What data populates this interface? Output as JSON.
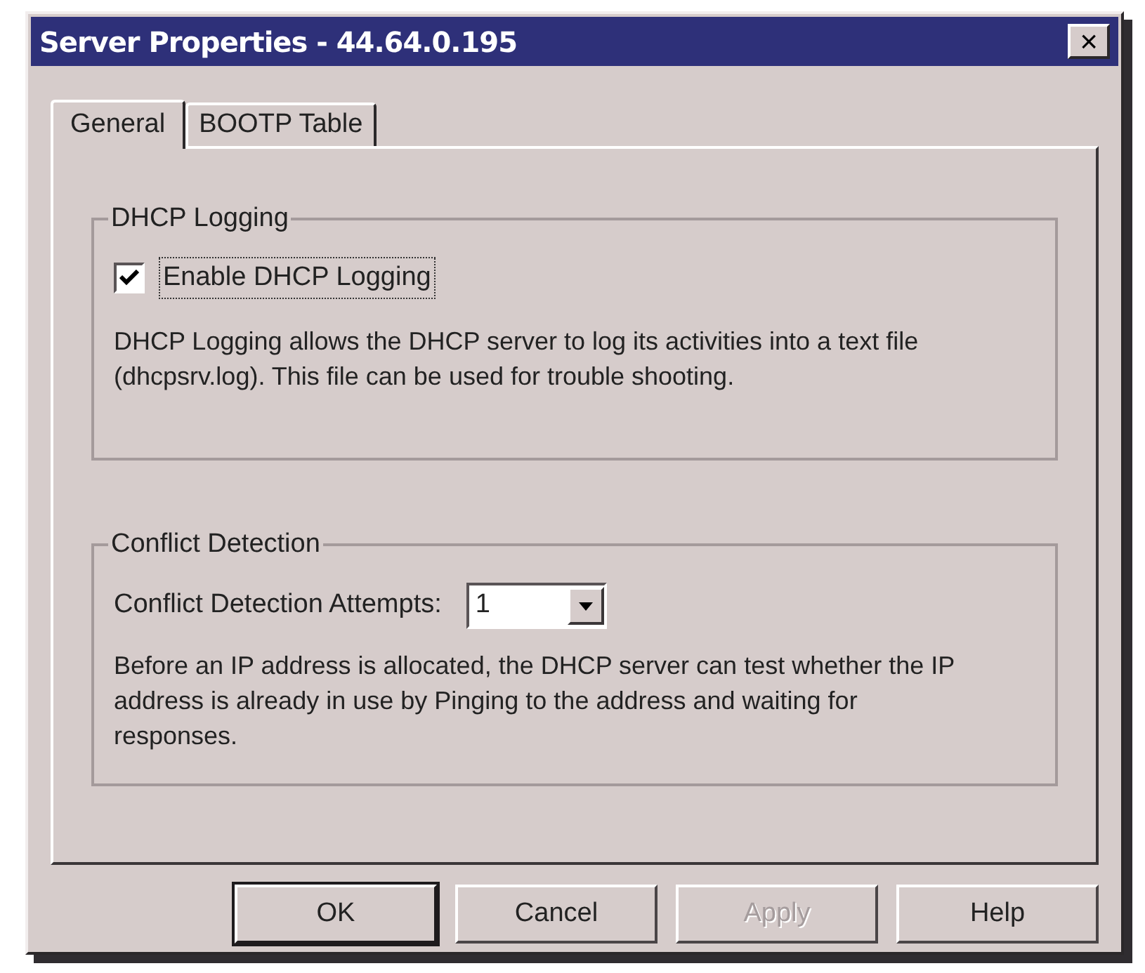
{
  "window": {
    "title": "Server Properties - 44.64.0.195",
    "close_button": "×"
  },
  "tabs": [
    {
      "label": "General",
      "selected": true
    },
    {
      "label": "BOOTP Table",
      "selected": false
    }
  ],
  "dhcp_logging": {
    "title": "DHCP Logging",
    "checkbox": {
      "label": "Enable DHCP Logging",
      "checked": true,
      "focused": true
    },
    "description": "DHCP Logging allows the DHCP server to log its activities into a text file (dhcpsrv.log).  This file can be used for trouble shooting."
  },
  "conflict_detection": {
    "title": "Conflict Detection",
    "attempts_label": "Conflict Detection Attempts:",
    "attempts_value": "1",
    "description": "Before an IP address is allocated, the DHCP server can test whether the IP address is already in use by Pinging to the address and waiting for responses."
  },
  "buttons": [
    {
      "label": "OK",
      "default": true,
      "disabled": false
    },
    {
      "label": "Cancel",
      "default": false,
      "disabled": false
    },
    {
      "label": "Apply",
      "default": false,
      "disabled": true
    },
    {
      "label": "Help",
      "default": false,
      "disabled": false
    }
  ]
}
